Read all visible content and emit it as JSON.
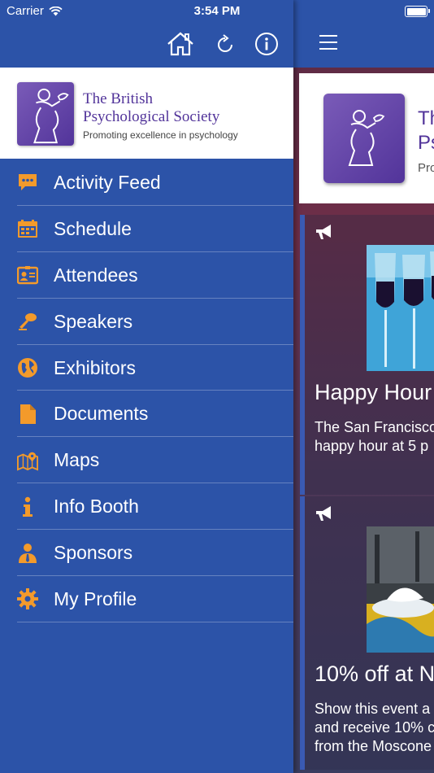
{
  "status_bar": {
    "carrier": "Carrier",
    "time": "3:54 PM"
  },
  "sidebar": {
    "header_icons": [
      "home-icon",
      "refresh-icon",
      "info-icon"
    ],
    "org": {
      "name_line1": "The British",
      "name_line2": "Psychological Society",
      "tagline": "Promoting excellence in psychology"
    },
    "items": [
      {
        "label": "Activity Feed",
        "icon": "chat-icon"
      },
      {
        "label": "Schedule",
        "icon": "calendar-icon"
      },
      {
        "label": "Attendees",
        "icon": "id-card-icon"
      },
      {
        "label": "Speakers",
        "icon": "microphone-icon"
      },
      {
        "label": "Exhibitors",
        "icon": "globe-icon"
      },
      {
        "label": "Documents",
        "icon": "document-icon"
      },
      {
        "label": "Maps",
        "icon": "map-icon"
      },
      {
        "label": "Info Booth",
        "icon": "info-icon"
      },
      {
        "label": "Sponsors",
        "icon": "person-icon"
      },
      {
        "label": "My Profile",
        "icon": "gear-icon"
      }
    ]
  },
  "main": {
    "logo_fragment_1": "Th",
    "logo_fragment_2": "Ps",
    "logo_fragment_3": "Pro",
    "posts": [
      {
        "title": "Happy Hour",
        "desc_line1": "The San Francisco",
        "desc_line2": "happy hour at 5 p",
        "desc_line3": ""
      },
      {
        "title": "10% off at N",
        "desc_line1": "Show this event a",
        "desc_line2": "and receive 10% c",
        "desc_line3": "from the Moscone"
      }
    ]
  },
  "colors": {
    "nav_bg": "#2c53a8",
    "icon_accent": "#f39a2b",
    "brand_purple": "#52349a"
  }
}
